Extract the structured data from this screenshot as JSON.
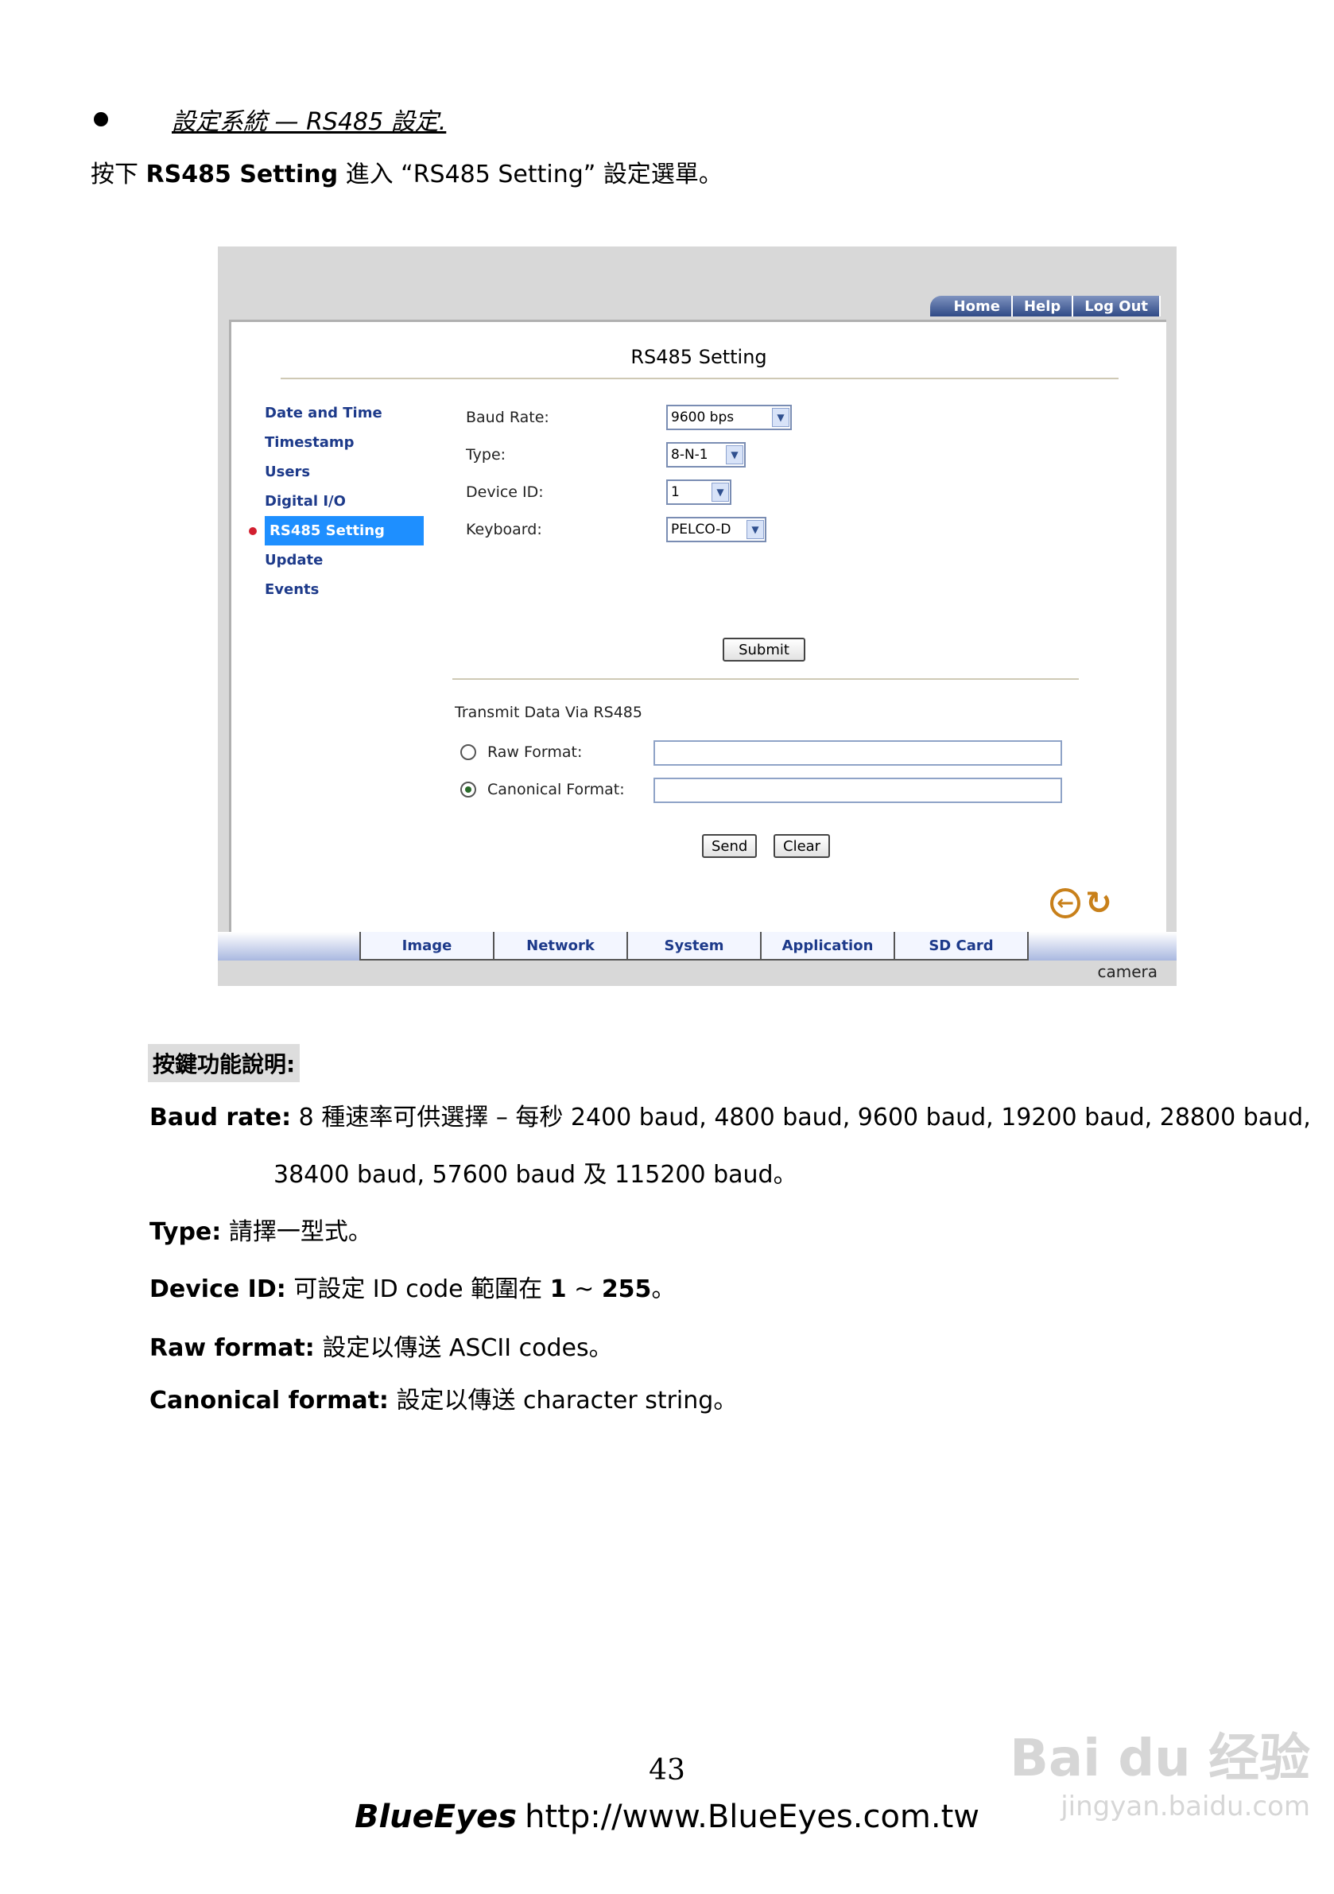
{
  "section": {
    "title": "設定系統 — RS485 設定."
  },
  "intro": {
    "prefix": "按下 ",
    "bold": "RS485 Setting",
    "suffix": " 進入 “RS485 Setting” 設定選單。"
  },
  "screenshot": {
    "top_nav": [
      "Home",
      "Help",
      "Log Out"
    ],
    "panel_title": "RS485 Setting",
    "sidebar": [
      "Date and Time",
      "Timestamp",
      "Users",
      "Digital I/O",
      "RS485 Setting",
      "Update",
      "Events"
    ],
    "sidebar_active": "RS485 Setting",
    "form": {
      "baud_label": "Baud Rate:",
      "baud_value": "9600 bps",
      "type_label": "Type:",
      "type_value": "8-N-1",
      "device_label": "Device ID:",
      "device_value": "1",
      "keyboard_label": "Keyboard:",
      "keyboard_value": "PELCO-D",
      "submit": "Submit"
    },
    "transmit": {
      "title": "Transmit Data Via RS485",
      "raw_label": "Raw Format:",
      "canonical_label": "Canonical Format:",
      "raw_value": "",
      "canonical_value": "",
      "send": "Send",
      "clear": "Clear"
    },
    "bottom_tabs": [
      "Image",
      "Network",
      "System",
      "Application",
      "SD Card"
    ],
    "brand": "camera"
  },
  "key_section_title": "按鍵功能說明:",
  "descriptions": {
    "baud": {
      "term": "Baud rate:",
      "text": " 8 種速率可供選擇 – 每秒 2400 baud, 4800 baud, 9600 baud, 19200 baud, 28800 baud,",
      "cont": "38400 baud, 57600 baud 及 115200 baud。"
    },
    "type": {
      "term": "Type:",
      "text": " 請擇一型式。"
    },
    "device": {
      "term": "Device ID:",
      "text": " 可設定 ID code 範圍在 ",
      "range_lo": "1",
      "range_sep": " ~ ",
      "range_hi": "255",
      "end": "。"
    },
    "raw": {
      "term": "Raw format:",
      "text": " 設定以傳送 ASCII codes。"
    },
    "canonical": {
      "term": "Canonical format:",
      "text": " 設定以傳送 character string。"
    }
  },
  "page_number": "43",
  "footer": {
    "brand": "BlueEyes",
    "url": "http://www.BlueEyes.com.tw"
  },
  "watermark": {
    "main": "Bai du 经验",
    "sub": "jingyan.baidu.com"
  }
}
